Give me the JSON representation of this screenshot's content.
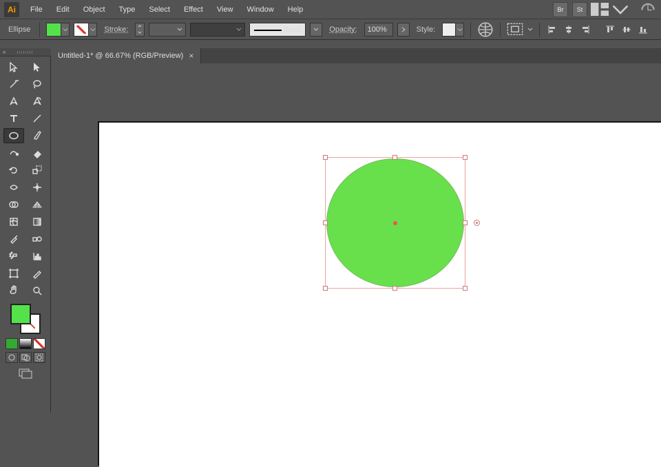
{
  "app": {
    "logo_text": "Ai"
  },
  "menu": {
    "items": [
      "File",
      "Edit",
      "Object",
      "Type",
      "Select",
      "Effect",
      "View",
      "Window",
      "Help"
    ],
    "right_icons": [
      "Br",
      "St"
    ]
  },
  "controlbar": {
    "shape_label": "Ellipse",
    "fill_color": "#54e24a",
    "stroke_label": "Stroke:",
    "stroke_value": "",
    "brush_label": "Basic",
    "opacity_label": "Opacity:",
    "opacity_value": "100%",
    "style_label": "Style:"
  },
  "document": {
    "tab_title": "Untitled-1* @ 66.67% (RGB/Preview)"
  },
  "tools": {
    "fill_color": "#54e24a"
  },
  "canvas": {
    "ellipse": {
      "fill": "#67e04b"
    }
  }
}
